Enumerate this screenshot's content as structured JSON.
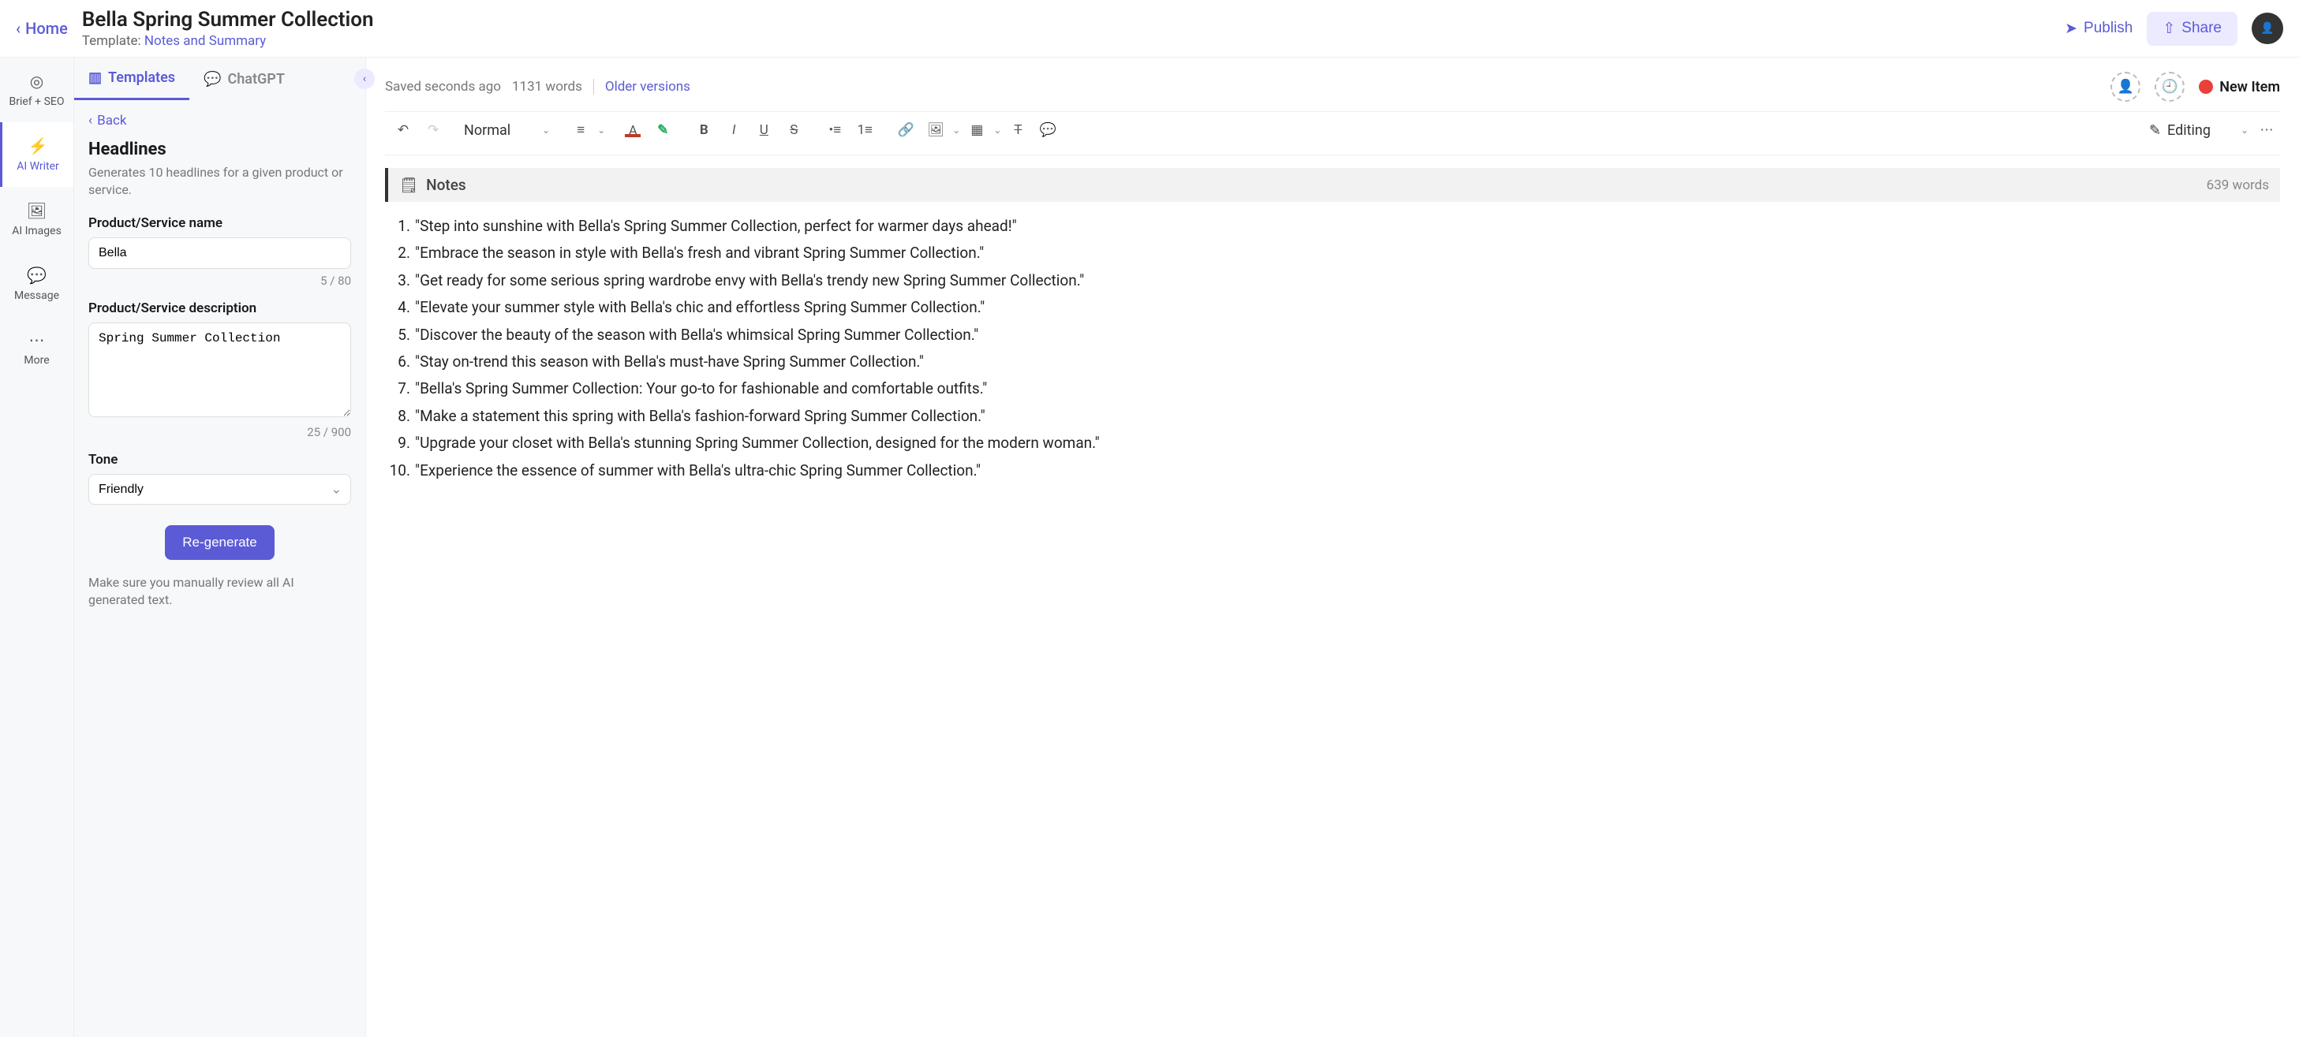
{
  "top": {
    "home_label": "Home",
    "title": "Bella Spring Summer Collection",
    "template_prefix": "Template: ",
    "template_name": "Notes and Summary",
    "publish_label": "Publish",
    "share_label": "Share"
  },
  "rail": {
    "items": [
      {
        "label": "Brief + SEO",
        "icon": "◎"
      },
      {
        "label": "AI Writer",
        "icon": "⚡"
      },
      {
        "label": "AI Images",
        "icon": "🖼"
      },
      {
        "label": "Message",
        "icon": "💬"
      },
      {
        "label": "More",
        "icon": "⋯"
      }
    ]
  },
  "panel": {
    "tab_templates": "Templates",
    "tab_chatgpt": "ChatGPT",
    "back_label": "Back",
    "heading": "Headlines",
    "description": "Generates 10 headlines for a given product or service.",
    "name_label": "Product/Service name",
    "name_value": "Bella",
    "name_counter": "5 / 80",
    "desc_label": "Product/Service description",
    "desc_value": "Spring Summer Collection",
    "desc_counter": "25 / 900",
    "tone_label": "Tone",
    "tone_value": "Friendly",
    "regen_label": "Re-generate",
    "review_note": "Make sure you manually review all AI generated text."
  },
  "editor": {
    "saved_label": "Saved seconds ago",
    "word_count": "1131 words",
    "older_label": "Older versions",
    "new_item_label": "New Item",
    "style_select": "Normal",
    "editing_label": "Editing",
    "notes_label": "Notes",
    "notes_wordcount": "639 words",
    "items": [
      "\"Step into sunshine with Bella's Spring Summer Collection, perfect for warmer days ahead!\"",
      "\"Embrace the season in style with Bella's fresh and vibrant Spring Summer Collection.\"",
      "\"Get ready for some serious spring wardrobe envy with Bella's trendy new Spring Summer Collection.\"",
      "\"Elevate your summer style with Bella's chic and effortless Spring Summer Collection.\"",
      "\"Discover the beauty of the season with Bella's whimsical Spring Summer Collection.\"",
      "\"Stay on-trend this season with Bella's must-have Spring Summer Collection.\"",
      "\"Bella's Spring Summer Collection: Your go-to for fashionable and comfortable outfits.\"",
      "\"Make a statement this spring with Bella's fashion-forward Spring Summer Collection.\"",
      "\"Upgrade your closet with Bella's stunning Spring Summer Collection, designed for the modern woman.\"",
      "\"Experience the essence of summer with Bella's ultra-chic Spring Summer Collection.\""
    ]
  }
}
